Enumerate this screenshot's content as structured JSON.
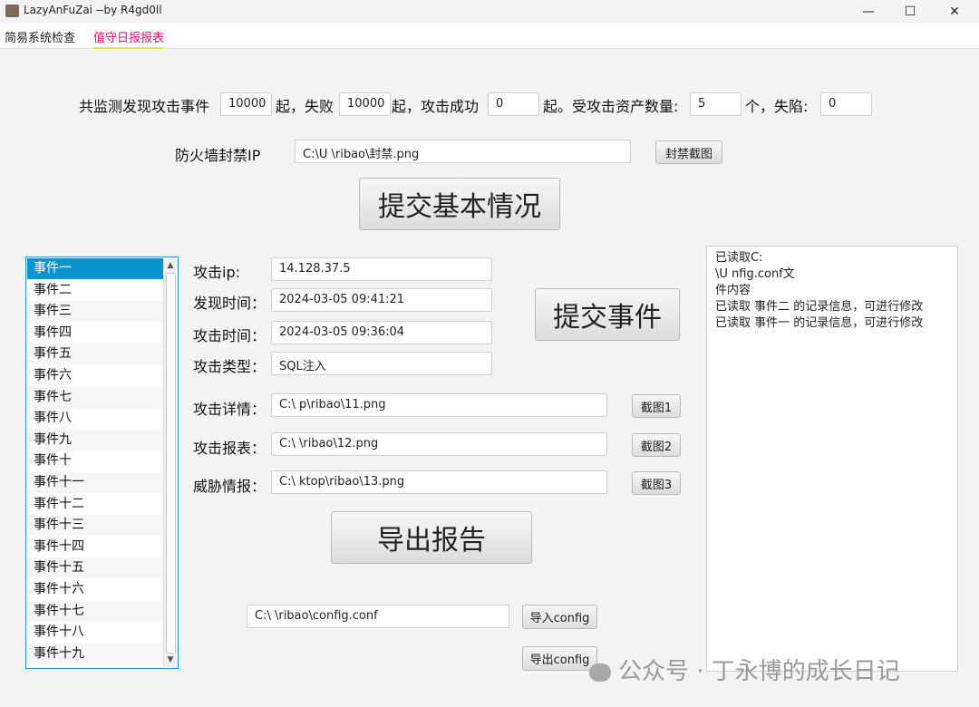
{
  "window": {
    "title": "LazyAnFuZai    --by R4gd0ll",
    "minimize": "—",
    "maximize": "☐",
    "close": "✕"
  },
  "menu": [
    {
      "label": "简易系统检查"
    },
    {
      "label": "值守日报报表"
    }
  ],
  "summary": {
    "label1": "共监测发现攻击事件",
    "total_events": "10000",
    "label2": "起，失败",
    "failed": "10000",
    "label3": "起，攻击成功",
    "success": "0",
    "label4": "起。受攻击资产数量:",
    "assets": "5",
    "label5": "个，失陷:",
    "compromised": "0"
  },
  "firewall": {
    "label": "防火墙封禁IP",
    "path": "C:\\U          \\ribao\\封禁.png",
    "screenshot_button": "封禁截图"
  },
  "submit_basic_button": "提交基本情况",
  "events": [
    "事件一",
    "事件二",
    "事件三",
    "事件四",
    "事件五",
    "事件六",
    "事件七",
    "事件八",
    "事件九",
    "事件十",
    "事件十一",
    "事件十二",
    "事件十三",
    "事件十四",
    "事件十五",
    "事件十六",
    "事件十七",
    "事件十八",
    "事件十九"
  ],
  "form": {
    "attack_ip_label": "攻击ip:",
    "attack_ip": "14.128.37.5",
    "discover_time_label": "发现时间：",
    "discover_time": "2024-03-05 09:41:21",
    "attack_time_label": "攻击时间：",
    "attack_time": "2024-03-05 09:36:04",
    "attack_type_label": "攻击类型：",
    "attack_type": "SQL注入",
    "submit_event_button": "提交事件",
    "detail_label": "攻击详情：",
    "detail_path": "C:\\          p\\ribao\\11.png",
    "detail_button": "截图1",
    "report_label": "攻击报表：",
    "report_path": "C:\\          \\ribao\\12.png",
    "report_button": "截图2",
    "intel_label": "威胁情报：",
    "intel_path": "C:\\          ktop\\ribao\\13.png",
    "intel_button": "截图3",
    "export_report_button": "导出报告"
  },
  "config": {
    "path": "C:\\          \\ribao\\config.conf",
    "import_button": "导入config",
    "export_button": "导出config"
  },
  "log": [
    "已读取C:",
    "\\U                    nfig.conf文",
    "件内容",
    "已读取 事件二 的记录信息，可进行修改",
    "已读取 事件一 的记录信息，可进行修改"
  ],
  "watermark": "公众号 · 丁永博的成长日记"
}
